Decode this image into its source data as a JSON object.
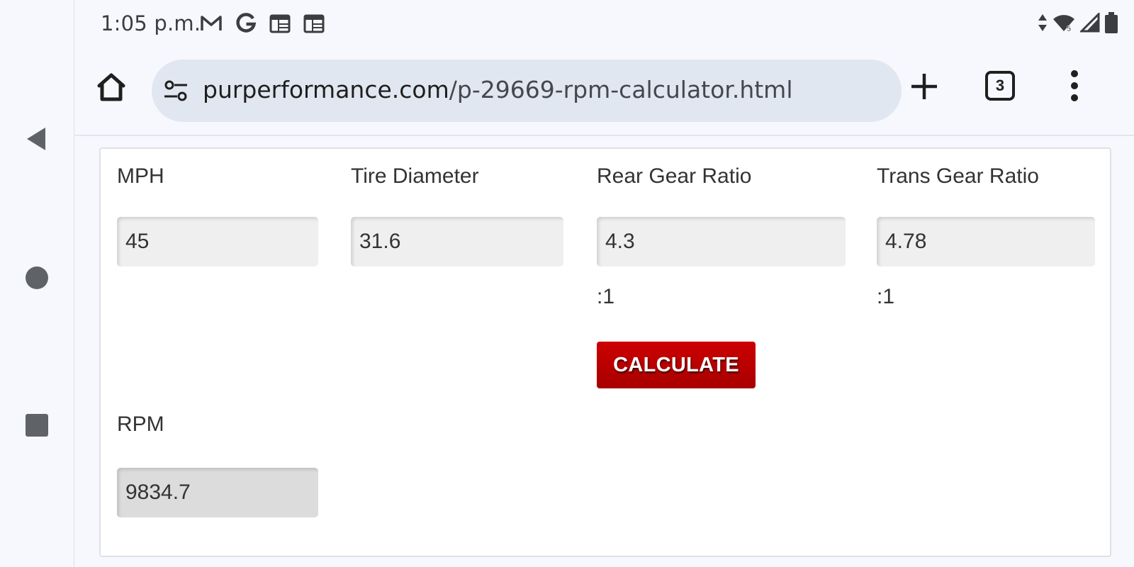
{
  "status_bar": {
    "time": "1:05 p.m.",
    "notification_icons": [
      "gmail-icon",
      "google-icon",
      "calendar-icon",
      "calendar-icon"
    ],
    "system_icons": [
      "data-arrows-icon",
      "wifi-icon",
      "cell-signal-icon",
      "battery-icon"
    ],
    "wifi_badge": "5"
  },
  "browser": {
    "url_domain": "purperformance.com",
    "url_path": "/p-29669-rpm-calculator.html",
    "tab_count": "3"
  },
  "calculator": {
    "mph": {
      "label": "MPH",
      "value": "45"
    },
    "tire_diameter": {
      "label": "Tire Diameter",
      "value": "31.6"
    },
    "rear_gear_ratio": {
      "label": "Rear Gear Ratio",
      "value": "4.3",
      "suffix": ":1"
    },
    "trans_gear_ratio": {
      "label": "Trans Gear Ratio",
      "value": "4.78",
      "suffix": ":1"
    },
    "calculate_label": "CALCULATE",
    "rpm": {
      "label": "RPM",
      "value": "9834.7"
    }
  },
  "colors": {
    "button_red": "#c00000",
    "browser_background": "#f7f8fd",
    "omnibox_background": "#e1e7f1"
  }
}
